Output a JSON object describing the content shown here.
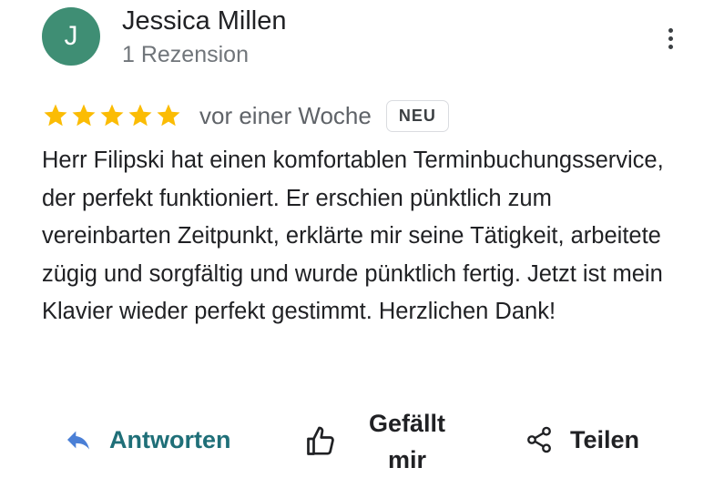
{
  "reviewer": {
    "initial": "J",
    "name": "Jessica Millen",
    "review_count": "1 Rezension",
    "avatar_color": "#3f8e74"
  },
  "rating": {
    "stars": 5,
    "max_stars": 5,
    "star_color": "#fbbc04",
    "time": "vor einer Woche",
    "badge": "NEU"
  },
  "review_text": "Herr Filipski hat einen komfortablen Terminbuchungsservice, der perfekt funktioniert. Er erschien pünktlich zum vereinbarten Zeitpunkt, erklärte mir seine Tätigkeit, arbeitete zügig und sorgfältig und wurde pünktlich fertig. Jetzt ist mein Klavier wieder perfekt gestimmt. Herzlichen Dank!",
  "actions": {
    "reply_label": "Antworten",
    "like_label": "Gefällt mir",
    "share_label": "Teilen",
    "reply_color": "#1f6f78"
  },
  "icons": {
    "more": "more-vertical-icon",
    "reply": "reply-arrow-icon",
    "like": "thumbs-up-icon",
    "share": "share-icon",
    "star": "star-icon"
  }
}
